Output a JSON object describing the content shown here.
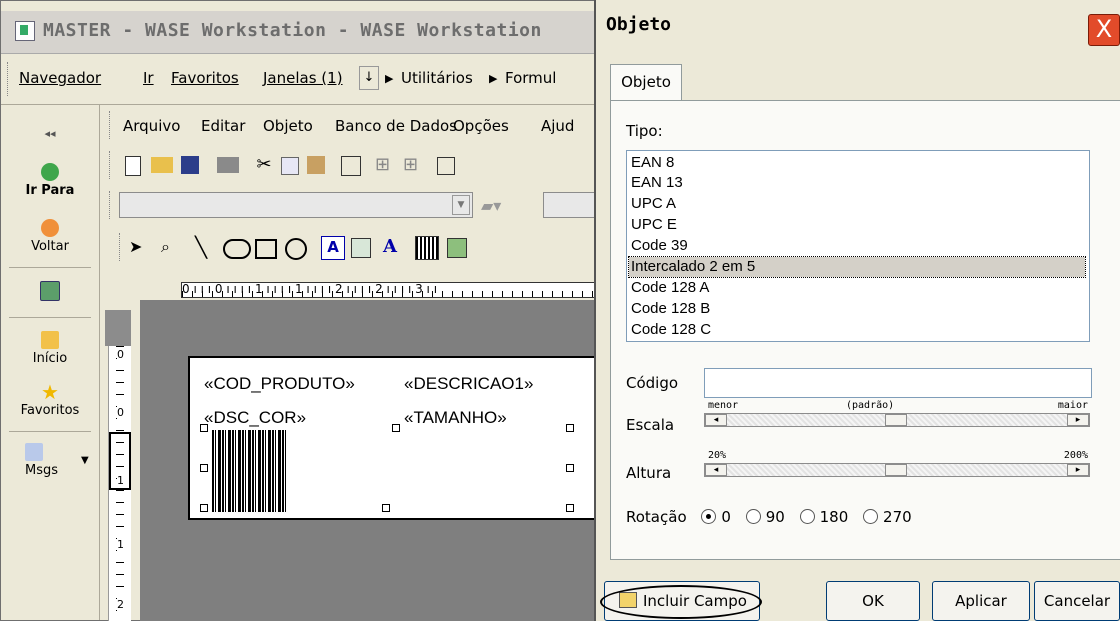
{
  "app": {
    "title": "MASTER - WASE Workstation - WASE Workstation",
    "menu": [
      "Navegador",
      "Ir",
      "Favoritos",
      "Janelas (1)",
      "Utilitários",
      "Formul"
    ],
    "menu_arrows": [
      "▶",
      "▶"
    ],
    "sidebar": {
      "collapse": "◂◂",
      "items": [
        "Ir Para",
        "Voltar",
        "Início",
        "Favoritos",
        "Msgs"
      ]
    },
    "editor_menu": [
      "Arquivo",
      "Editar",
      "Objeto",
      "Banco de Dados",
      "Opções",
      "Ajud"
    ],
    "ruler": "0 ı ı ı 0 ı ı ı ı 1 ı ı ı ı 1 ı ı ı ı 2 ı ı ı ı 2 ı ı ı ı 3 ı ı",
    "vruler_marks": [
      "0",
      "0",
      "1",
      "1",
      "2"
    ],
    "label_fields": {
      "cod_produto": "«COD_PRODUTO»",
      "descricao": "«DESCRICAO1»",
      "dsc_cor": "«DSC_COR»",
      "tamanho": "«TAMANHO»"
    }
  },
  "dialog": {
    "title": "Objeto",
    "close": "X",
    "tab": "Objeto",
    "tipo_label": "Tipo:",
    "tipos": [
      "EAN 8",
      "EAN 13",
      "UPC A",
      "UPC E",
      "Code 39",
      "Intercalado 2 em 5",
      "Code 128 A",
      "Code 128 B",
      "Code 128 C"
    ],
    "selected_tipo": "Intercalado 2 em 5",
    "codigo_label": "Código",
    "codigo_value": "",
    "escala_label": "Escala",
    "escala_ticks": [
      "menor",
      "(padrão)",
      "maior"
    ],
    "escala_level": 0.5,
    "altura_label": "Altura",
    "altura_ticks": [
      "20%",
      "200%"
    ],
    "altura_level": 0.5,
    "rotacao_label": "Rotação",
    "rotacao_options": [
      "0",
      "90",
      "180",
      "270"
    ],
    "rotacao_selected": "0",
    "buttons": {
      "incluir_campo": "Incluir Campo",
      "ok": "OK",
      "aplicar": "Aplicar",
      "cancelar": "Cancelar"
    }
  },
  "colors": {
    "face": "#ece9d8",
    "close_red": "#e24b2a",
    "selection": "#d4d0c8"
  }
}
